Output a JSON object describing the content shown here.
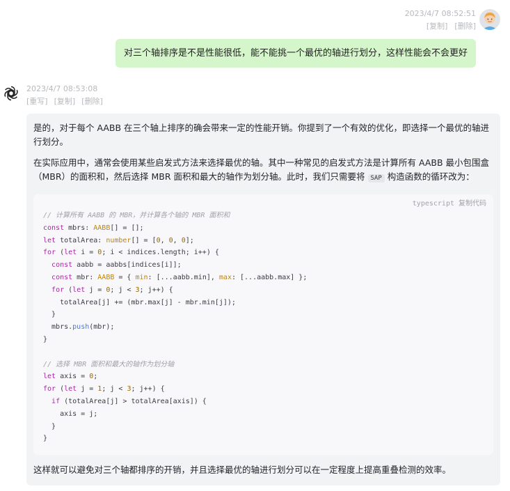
{
  "user_message": {
    "timestamp": "2023/4/7 08:52:51",
    "actions": [
      "[复制]",
      "[删除]"
    ],
    "text": "对三个轴排序是不是性能很低，能不能挑一个最优的轴进行划分，这样性能会不会更好"
  },
  "assistant_message": {
    "timestamp": "2023/4/7 08:53:08",
    "actions": [
      "[重写]",
      "[复制]",
      "[删除]"
    ],
    "paragraph1": "是的，对于每个 AABB 在三个轴上排序的确会带来一定的性能开销。你提到了一个有效的优化，即选择一个最优的轴进行划分。",
    "paragraph2_before": "在实际应用中，通常会使用某些启发式方法来选择最优的轴。其中一种常见的启发式方法是计算所有 AABB 最小包围盒（MBR）的面积和，然后选择 MBR 面积和最大的轴作为划分轴。此时，我们只需要将 ",
    "paragraph2_code": "SAP",
    "paragraph2_after": " 构造函数的循环改为：",
    "code_language": "typescript",
    "copy_code_label": "复制代码",
    "code_lines": [
      [
        [
          "comment",
          "// 计算所有 AABB 的 MBR，并计算各个轴的 MBR 面积和"
        ]
      ],
      [
        [
          "keyword",
          "const"
        ],
        [
          "default",
          " mbrs: "
        ],
        [
          "type",
          "AABB"
        ],
        [
          "default",
          "[] = [];"
        ]
      ],
      [
        [
          "keyword",
          "let"
        ],
        [
          "default",
          " totalArea: "
        ],
        [
          "type",
          "number"
        ],
        [
          "default",
          "[] = ["
        ],
        [
          "number",
          "0"
        ],
        [
          "default",
          ", "
        ],
        [
          "number",
          "0"
        ],
        [
          "default",
          ", "
        ],
        [
          "number",
          "0"
        ],
        [
          "default",
          "];"
        ]
      ],
      [
        [
          "keyword",
          "for"
        ],
        [
          "default",
          " ("
        ],
        [
          "keyword",
          "let"
        ],
        [
          "default",
          " i = "
        ],
        [
          "number",
          "0"
        ],
        [
          "default",
          "; i < indices.length; i++) {"
        ]
      ],
      [
        [
          "default",
          "  "
        ],
        [
          "keyword",
          "const"
        ],
        [
          "default",
          " aabb = aabbs[indices[i]];"
        ]
      ],
      [
        [
          "default",
          "  "
        ],
        [
          "keyword",
          "const"
        ],
        [
          "default",
          " mbr: "
        ],
        [
          "type",
          "AABB"
        ],
        [
          "default",
          " = { "
        ],
        [
          "type",
          "min"
        ],
        [
          "default",
          ": [...aabb.min], "
        ],
        [
          "type",
          "max"
        ],
        [
          "default",
          ": [...aabb.max] };"
        ]
      ],
      [
        [
          "default",
          "  "
        ],
        [
          "keyword",
          "for"
        ],
        [
          "default",
          " ("
        ],
        [
          "keyword",
          "let"
        ],
        [
          "default",
          " j = "
        ],
        [
          "number",
          "0"
        ],
        [
          "default",
          "; j < "
        ],
        [
          "number",
          "3"
        ],
        [
          "default",
          "; j++) {"
        ]
      ],
      [
        [
          "default",
          "    totalArea[j] += (mbr.max[j] - mbr.min[j]);"
        ]
      ],
      [
        [
          "default",
          "  }"
        ]
      ],
      [
        [
          "default",
          "  mbrs."
        ],
        [
          "func",
          "push"
        ],
        [
          "default",
          "(mbr);"
        ]
      ],
      [
        [
          "default",
          "}"
        ]
      ],
      [
        [
          "default",
          ""
        ]
      ],
      [
        [
          "comment",
          "// 选择 MBR 面积和最大的轴作为划分轴"
        ]
      ],
      [
        [
          "keyword",
          "let"
        ],
        [
          "default",
          " axis = "
        ],
        [
          "number",
          "0"
        ],
        [
          "default",
          ";"
        ]
      ],
      [
        [
          "keyword",
          "for"
        ],
        [
          "default",
          " ("
        ],
        [
          "keyword",
          "let"
        ],
        [
          "default",
          " j = "
        ],
        [
          "number",
          "1"
        ],
        [
          "default",
          "; j < "
        ],
        [
          "number",
          "3"
        ],
        [
          "default",
          "; j++) {"
        ]
      ],
      [
        [
          "default",
          "  "
        ],
        [
          "keyword",
          "if"
        ],
        [
          "default",
          " (totalArea[j] > totalArea[axis]) {"
        ]
      ],
      [
        [
          "default",
          "    axis = j;"
        ]
      ],
      [
        [
          "default",
          "  }"
        ]
      ],
      [
        [
          "default",
          "}"
        ]
      ]
    ],
    "paragraph3": "这样就可以避免对三个轴都排序的开销，并且选择最优的轴进行划分可以在一定程度上提高重叠检测的效率。"
  }
}
